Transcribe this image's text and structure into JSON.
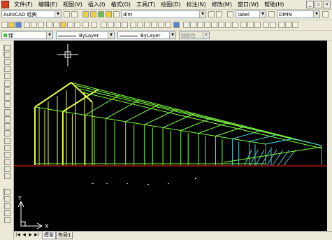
{
  "menu": {
    "items": [
      "文件(F)",
      "编辑(E)",
      "视图(V)",
      "插入(I)",
      "格式(O)",
      "工具(T)",
      "绘图(D)",
      "标注(N)",
      "修改(M)",
      "窗口(W)",
      "帮助(H)"
    ]
  },
  "toolbar1": {
    "workspace": "AutoCAD 经典",
    "text_style": "dim",
    "dim_style": "label",
    "table_style": "DIMN"
  },
  "toolbar3": {
    "layer": "绿",
    "linetype": "ByLayer",
    "lineweight": "ByLayer",
    "plotstyle": "随颜色"
  },
  "canvas": {
    "ucs_y": "Y",
    "ucs_x": "X"
  },
  "tabs": {
    "model": "模型",
    "layout": "布局1"
  },
  "colors": {
    "canvas_bg": "#000000",
    "structure": "#7fff3f",
    "highlight": "#e8ff40",
    "cyan": "#40d0e0",
    "ground": "#ff2020"
  }
}
